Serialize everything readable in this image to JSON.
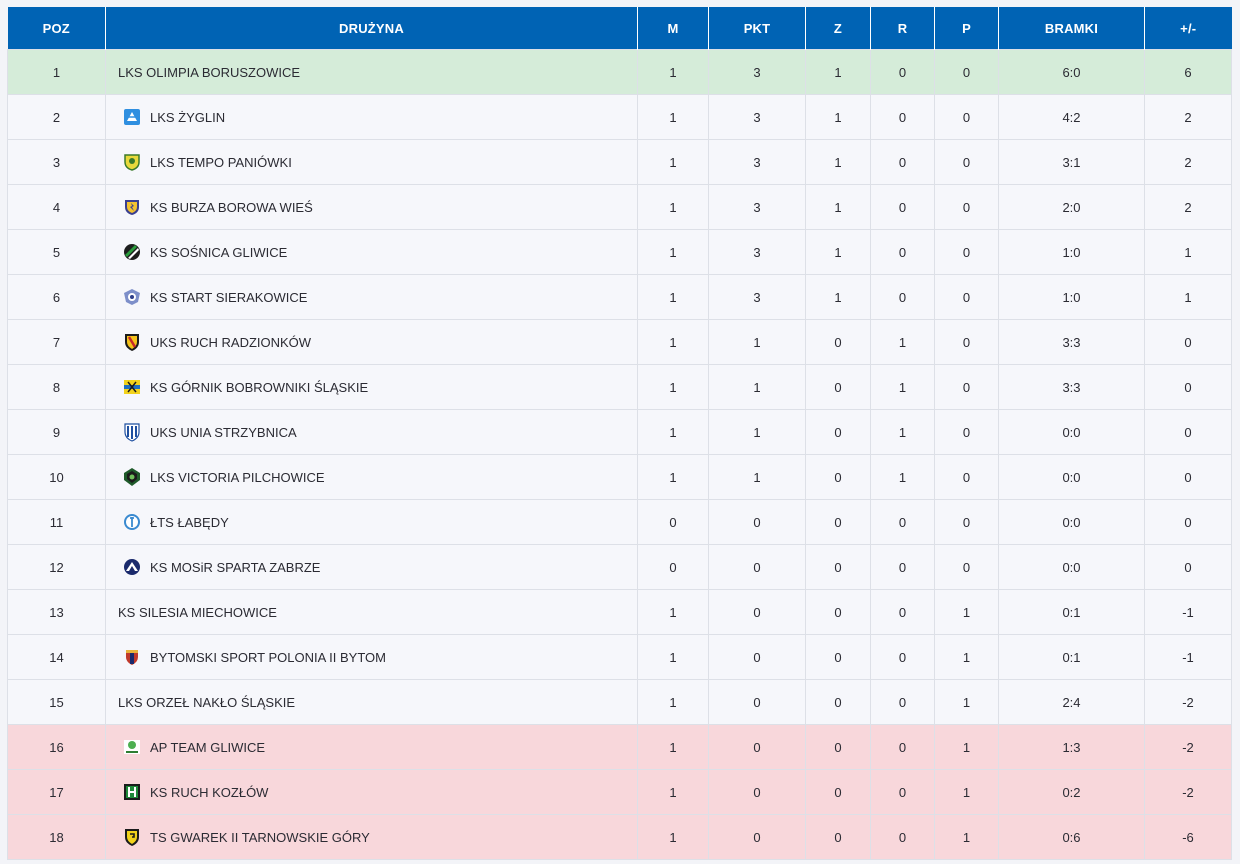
{
  "headers": {
    "poz": "POZ",
    "team": "DRUŻYNA",
    "m": "M",
    "pkt": "PKT",
    "z": "Z",
    "r": "R",
    "p": "P",
    "bramki": "BRAMKI",
    "diff": "+/-"
  },
  "colors": {
    "header_bg": "#0063b4",
    "promotion_row": "#d5ecd9",
    "relegation_row": "#f8d7db",
    "row_bg": "#f6f7fb"
  },
  "rows": [
    {
      "poz": "1",
      "team": "LKS OLIMPIA BORUSZOWICE",
      "logo": "",
      "m": "1",
      "pkt": "3",
      "z": "1",
      "r": "0",
      "p": "0",
      "bramki": "6:0",
      "diff": "6",
      "zone": "promo"
    },
    {
      "poz": "2",
      "team": "LKS ŻYGLIN",
      "logo": "zyglin-crest-icon",
      "m": "1",
      "pkt": "3",
      "z": "1",
      "r": "0",
      "p": "0",
      "bramki": "4:2",
      "diff": "2",
      "zone": ""
    },
    {
      "poz": "3",
      "team": "LKS TEMPO PANIÓWKI",
      "logo": "tempo-crest-icon",
      "m": "1",
      "pkt": "3",
      "z": "1",
      "r": "0",
      "p": "0",
      "bramki": "3:1",
      "diff": "2",
      "zone": ""
    },
    {
      "poz": "4",
      "team": "KS BURZA BOROWA WIEŚ",
      "logo": "burza-crest-icon",
      "m": "1",
      "pkt": "3",
      "z": "1",
      "r": "0",
      "p": "0",
      "bramki": "2:0",
      "diff": "2",
      "zone": ""
    },
    {
      "poz": "5",
      "team": "KS SOŚNICA GLIWICE",
      "logo": "sosnica-crest-icon",
      "m": "1",
      "pkt": "3",
      "z": "1",
      "r": "0",
      "p": "0",
      "bramki": "1:0",
      "diff": "1",
      "zone": ""
    },
    {
      "poz": "6",
      "team": "KS START SIERAKOWICE",
      "logo": "start-crest-icon",
      "m": "1",
      "pkt": "3",
      "z": "1",
      "r": "0",
      "p": "0",
      "bramki": "1:0",
      "diff": "1",
      "zone": ""
    },
    {
      "poz": "7",
      "team": "UKS RUCH RADZIONKÓW",
      "logo": "ruch-radzionkow-crest-icon",
      "m": "1",
      "pkt": "1",
      "z": "0",
      "r": "1",
      "p": "0",
      "bramki": "3:3",
      "diff": "0",
      "zone": ""
    },
    {
      "poz": "8",
      "team": "KS GÓRNIK BOBROWNIKI ŚLĄSKIE",
      "logo": "gornik-crest-icon",
      "m": "1",
      "pkt": "1",
      "z": "0",
      "r": "1",
      "p": "0",
      "bramki": "3:3",
      "diff": "0",
      "zone": ""
    },
    {
      "poz": "9",
      "team": "UKS UNIA STRZYBNICA",
      "logo": "unia-crest-icon",
      "m": "1",
      "pkt": "1",
      "z": "0",
      "r": "1",
      "p": "0",
      "bramki": "0:0",
      "diff": "0",
      "zone": ""
    },
    {
      "poz": "10",
      "team": "LKS VICTORIA PILCHOWICE",
      "logo": "victoria-crest-icon",
      "m": "1",
      "pkt": "1",
      "z": "0",
      "r": "1",
      "p": "0",
      "bramki": "0:0",
      "diff": "0",
      "zone": ""
    },
    {
      "poz": "11",
      "team": "ŁTS ŁABĘDY",
      "logo": "lts-crest-icon",
      "m": "0",
      "pkt": "0",
      "z": "0",
      "r": "0",
      "p": "0",
      "bramki": "0:0",
      "diff": "0",
      "zone": ""
    },
    {
      "poz": "12",
      "team": "KS MOSiR SPARTA ZABRZE",
      "logo": "sparta-crest-icon",
      "m": "0",
      "pkt": "0",
      "z": "0",
      "r": "0",
      "p": "0",
      "bramki": "0:0",
      "diff": "0",
      "zone": ""
    },
    {
      "poz": "13",
      "team": "KS SILESIA MIECHOWICE",
      "logo": "",
      "m": "1",
      "pkt": "0",
      "z": "0",
      "r": "0",
      "p": "1",
      "bramki": "0:1",
      "diff": "-1",
      "zone": ""
    },
    {
      "poz": "14",
      "team": "BYTOMSKI SPORT POLONIA II BYTOM",
      "logo": "polonia-crest-icon",
      "m": "1",
      "pkt": "0",
      "z": "0",
      "r": "0",
      "p": "1",
      "bramki": "0:1",
      "diff": "-1",
      "zone": ""
    },
    {
      "poz": "15",
      "team": "LKS ORZEŁ NAKŁO ŚLĄSKIE",
      "logo": "",
      "m": "1",
      "pkt": "0",
      "z": "0",
      "r": "0",
      "p": "1",
      "bramki": "2:4",
      "diff": "-2",
      "zone": ""
    },
    {
      "poz": "16",
      "team": "AP TEAM GLIWICE",
      "logo": "ap-team-crest-icon",
      "m": "1",
      "pkt": "0",
      "z": "0",
      "r": "0",
      "p": "1",
      "bramki": "1:3",
      "diff": "-2",
      "zone": "releg"
    },
    {
      "poz": "17",
      "team": "KS RUCH KOZŁÓW",
      "logo": "ruch-kozlow-crest-icon",
      "m": "1",
      "pkt": "0",
      "z": "0",
      "r": "0",
      "p": "1",
      "bramki": "0:2",
      "diff": "-2",
      "zone": "releg"
    },
    {
      "poz": "18",
      "team": "TS GWAREK II TARNOWSKIE GÓRY",
      "logo": "gwarek-crest-icon",
      "m": "1",
      "pkt": "0",
      "z": "0",
      "r": "0",
      "p": "1",
      "bramki": "0:6",
      "diff": "-6",
      "zone": "releg"
    }
  ]
}
